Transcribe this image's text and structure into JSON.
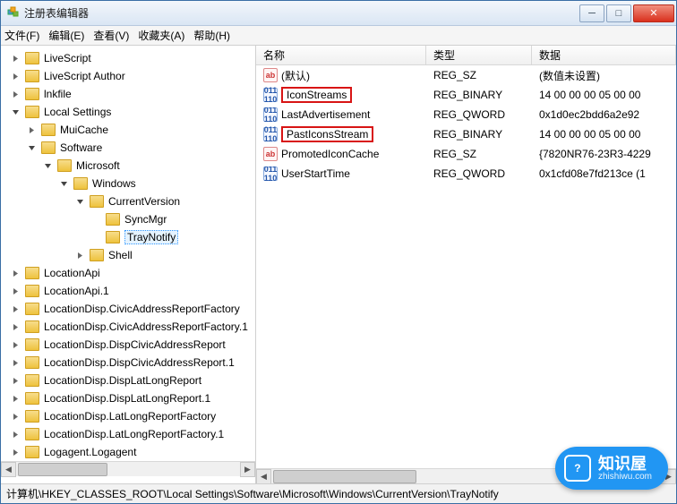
{
  "window": {
    "title": "注册表编辑器"
  },
  "menu": {
    "file": "文件(F)",
    "edit": "编辑(E)",
    "view": "查看(V)",
    "fav": "收藏夹(A)",
    "help": "帮助(H)"
  },
  "tree": {
    "items": [
      {
        "label": "LiveScript",
        "exp": "closed",
        "depth": 2
      },
      {
        "label": "LiveScript Author",
        "exp": "closed",
        "depth": 2
      },
      {
        "label": "lnkfile",
        "exp": "closed",
        "depth": 2
      },
      {
        "label": "Local Settings",
        "exp": "open",
        "depth": 2
      },
      {
        "label": "MuiCache",
        "exp": "closed",
        "depth": 3
      },
      {
        "label": "Software",
        "exp": "open",
        "depth": 3
      },
      {
        "label": "Microsoft",
        "exp": "open",
        "depth": 4
      },
      {
        "label": "Windows",
        "exp": "open",
        "depth": 5
      },
      {
        "label": "CurrentVersion",
        "exp": "open",
        "depth": 6
      },
      {
        "label": "SyncMgr",
        "exp": "none",
        "depth": 7
      },
      {
        "label": "TrayNotify",
        "exp": "none",
        "depth": 7,
        "highlight": true,
        "sel": true
      },
      {
        "label": "Shell",
        "exp": "closed",
        "depth": 6
      },
      {
        "label": "LocationApi",
        "exp": "closed",
        "depth": 2
      },
      {
        "label": "LocationApi.1",
        "exp": "closed",
        "depth": 2
      },
      {
        "label": "LocationDisp.CivicAddressReportFactory",
        "exp": "closed",
        "depth": 2
      },
      {
        "label": "LocationDisp.CivicAddressReportFactory.1",
        "exp": "closed",
        "depth": 2
      },
      {
        "label": "LocationDisp.DispCivicAddressReport",
        "exp": "closed",
        "depth": 2
      },
      {
        "label": "LocationDisp.DispCivicAddressReport.1",
        "exp": "closed",
        "depth": 2
      },
      {
        "label": "LocationDisp.DispLatLongReport",
        "exp": "closed",
        "depth": 2
      },
      {
        "label": "LocationDisp.DispLatLongReport.1",
        "exp": "closed",
        "depth": 2
      },
      {
        "label": "LocationDisp.LatLongReportFactory",
        "exp": "closed",
        "depth": 2
      },
      {
        "label": "LocationDisp.LatLongReportFactory.1",
        "exp": "closed",
        "depth": 2
      },
      {
        "label": "Logagent.Logagent",
        "exp": "closed",
        "depth": 2
      }
    ]
  },
  "list": {
    "cols": {
      "name": "名称",
      "type": "类型",
      "data": "数据"
    },
    "rows": [
      {
        "icon": "str",
        "name": "(默认)",
        "type": "REG_SZ",
        "data": "(数值未设置)",
        "hl": false
      },
      {
        "icon": "bin",
        "name": "IconStreams",
        "type": "REG_BINARY",
        "data": "14 00 00 00 05 00 00 ",
        "hl": true
      },
      {
        "icon": "bin",
        "name": "LastAdvertisement",
        "type": "REG_QWORD",
        "data": "0x1d0ec2bdd6a2e92 ",
        "hl": false
      },
      {
        "icon": "bin",
        "name": "PastIconsStream",
        "type": "REG_BINARY",
        "data": "14 00 00 00 05 00 00 ",
        "hl": true
      },
      {
        "icon": "str",
        "name": "PromotedIconCache",
        "type": "REG_SZ",
        "data": "{7820NR76-23R3-4229",
        "hl": false
      },
      {
        "icon": "bin",
        "name": "UserStartTime",
        "type": "REG_QWORD",
        "data": "0x1cfd08e7fd213ce (1",
        "hl": false
      }
    ]
  },
  "status": {
    "path": "计算机\\HKEY_CLASSES_ROOT\\Local Settings\\Software\\Microsoft\\Windows\\CurrentVersion\\TrayNotify"
  },
  "watermark": {
    "q": "?",
    "name": "知识屋",
    "url": "zhishiwu.com"
  }
}
